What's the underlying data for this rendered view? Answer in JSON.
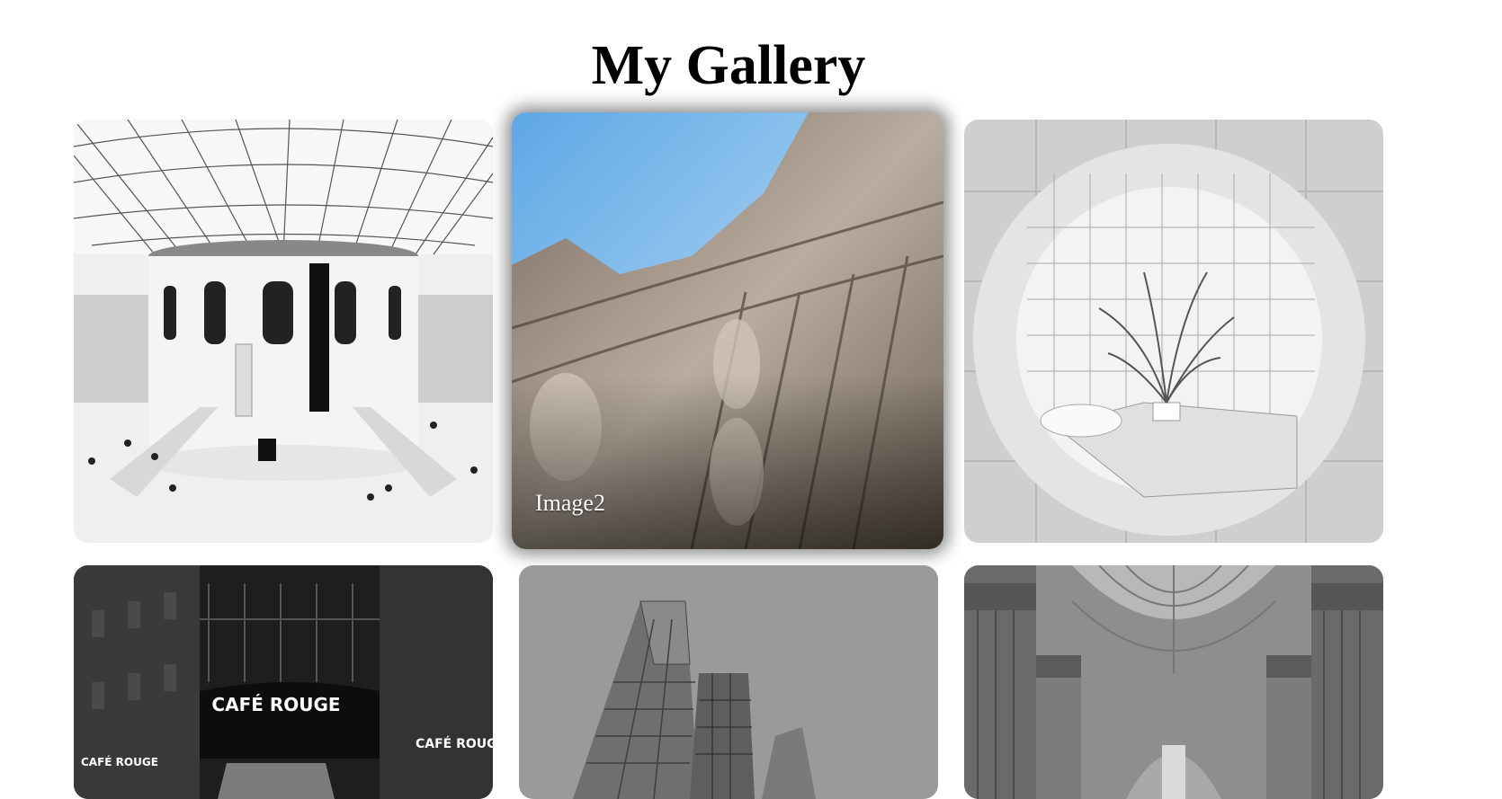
{
  "page": {
    "title": "My Gallery"
  },
  "gallery": {
    "hovered_caption": "Image2",
    "items": [
      {
        "sign_main": "",
        "sign_left": "",
        "sign_right": ""
      },
      {
        "caption": "Image2"
      },
      {},
      {
        "sign_main": "CAFÉ ROUGE",
        "sign_left": "CAFÉ ROUGE",
        "sign_right": "CAFÉ ROUGE"
      },
      {},
      {}
    ]
  }
}
